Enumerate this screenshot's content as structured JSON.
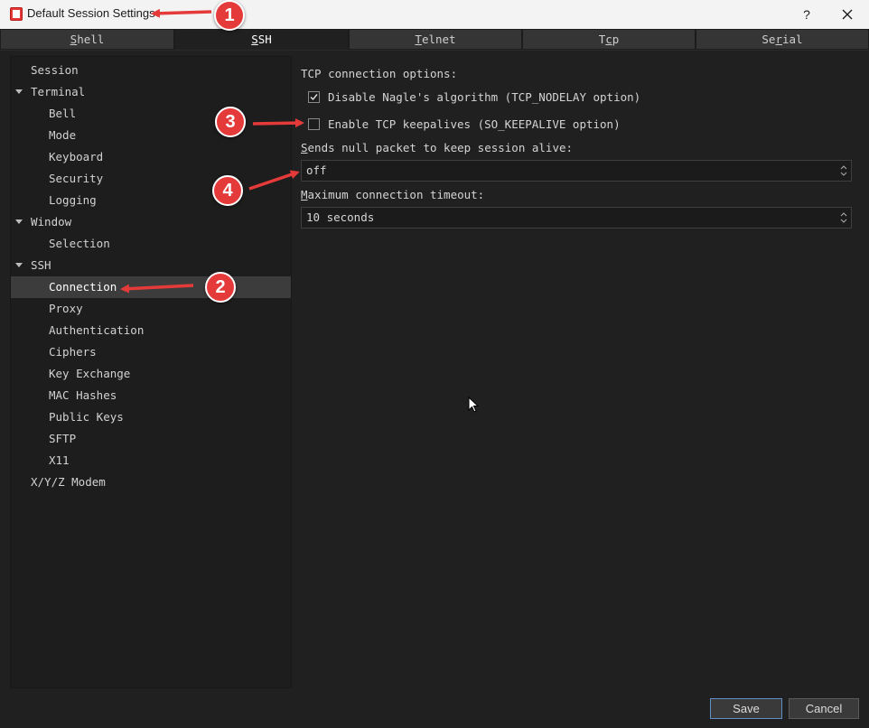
{
  "window": {
    "title": "Default Session Settings",
    "help": "?"
  },
  "tabs": [
    {
      "pre": "",
      "u": "S",
      "post": "hell"
    },
    {
      "pre": "",
      "u": "S",
      "post": "SH"
    },
    {
      "pre": "",
      "u": "T",
      "post": "elnet"
    },
    {
      "pre": "T",
      "u": "c",
      "post": "p"
    },
    {
      "pre": "Se",
      "u": "r",
      "post": "ial"
    }
  ],
  "active_tab": "SSH",
  "tree": {
    "items": [
      {
        "label": "Session"
      },
      {
        "label": "Terminal"
      },
      {
        "label": "Bell"
      },
      {
        "label": "Mode"
      },
      {
        "label": "Keyboard"
      },
      {
        "label": "Security"
      },
      {
        "label": "Logging"
      },
      {
        "label": "Window"
      },
      {
        "label": "Selection"
      },
      {
        "label": "SSH"
      },
      {
        "label": "Connection"
      },
      {
        "label": "Proxy"
      },
      {
        "label": "Authentication"
      },
      {
        "label": "Ciphers"
      },
      {
        "label": "Key Exchange"
      },
      {
        "label": "MAC Hashes"
      },
      {
        "label": "Public Keys"
      },
      {
        "label": "SFTP"
      },
      {
        "label": "X11"
      },
      {
        "label": "X/Y/Z Modem"
      }
    ],
    "selected": "Connection"
  },
  "panel": {
    "section_title": "TCP connection options:",
    "nagle": {
      "label": "Disable Nagle's algorithm (TCP_NODELAY option)",
      "checked": true
    },
    "keepalive": {
      "label": "Enable TCP keepalives (SO_KEEPALIVE option)",
      "checked": false
    },
    "null_packet": {
      "label_u": "S",
      "label_rest": "ends null packet to keep session alive:",
      "value": "off"
    },
    "timeout": {
      "label_u": "M",
      "label_rest": "aximum connection timeout:",
      "value": "10 seconds"
    }
  },
  "buttons": {
    "save": "Save",
    "cancel": "Cancel"
  },
  "annotations": [
    {
      "number": "1",
      "target": "window title"
    },
    {
      "number": "2",
      "target": "Connection"
    },
    {
      "number": "3",
      "target": "Enable TCP keepalives"
    },
    {
      "number": "4",
      "target": "Sends null packet field"
    }
  ],
  "colors": {
    "accent_red": "#e53a3a",
    "background": "#202020",
    "selected_row": "#3c3c3c",
    "primary_border": "#5f8fc9"
  }
}
